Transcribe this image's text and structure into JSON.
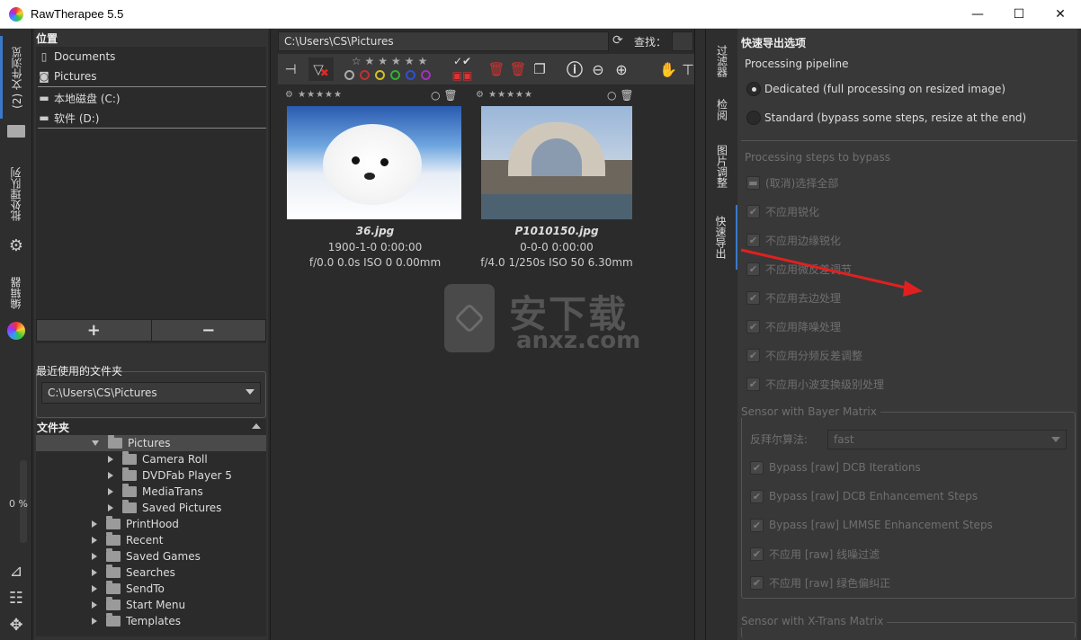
{
  "titlebar": {
    "title": "RawTherapee 5.5",
    "minimize": "—",
    "maximize": "☐",
    "close": "✕"
  },
  "left_tabs": {
    "file_browser": "(2) 文件浏览",
    "batch_queue": "批处理队列",
    "editor": "编辑器",
    "progress": "0 %"
  },
  "places": {
    "header": "位置",
    "items": [
      "Documents",
      "Pictures"
    ],
    "drives": [
      "本地磁盘 (C:)",
      "软件 (D:)"
    ],
    "add": "+",
    "remove": "−"
  },
  "recent": {
    "header": "最近使用的文件夹",
    "value": "C:\\Users\\CS\\Pictures"
  },
  "folders": {
    "header": "文件夹",
    "tree": [
      {
        "name": "Pictures",
        "expanded": true
      },
      {
        "name": "Camera Roll"
      },
      {
        "name": "DVDFab Player 5"
      },
      {
        "name": "MediaTrans"
      },
      {
        "name": "Saved Pictures"
      },
      {
        "name": "PrintHood"
      },
      {
        "name": "Recent"
      },
      {
        "name": "Saved Games"
      },
      {
        "name": "Searches"
      },
      {
        "name": "SendTo"
      },
      {
        "name": "Start Menu"
      },
      {
        "name": "Templates"
      }
    ]
  },
  "browser": {
    "path": "C:\\Users\\CS\\Pictures",
    "find_label": "查找：",
    "thumbnails": [
      {
        "filename": "36.jpg",
        "date": "1900-1-0 0:00:00",
        "exif": "f/0.0 0.0s ISO 0 0.00mm"
      },
      {
        "filename": "P1010150.jpg",
        "date": "0-0-0 0:00:00",
        "exif": "f/4.0 1/250s ISO 50 6.30mm"
      }
    ],
    "color_labels": [
      "#c03030",
      "#d0c020",
      "#30b030",
      "#3050d0",
      "#a030c0"
    ]
  },
  "watermark": {
    "zh": "安下载",
    "en": "anxz.com"
  },
  "right_tabs": [
    "过滤器",
    "检阅",
    "图片调整",
    "快速导出"
  ],
  "export": {
    "title": "快速导出选项",
    "pipeline_label": "Processing pipeline",
    "options": [
      {
        "label": "Dedicated (full processing on resized image)",
        "selected": true
      },
      {
        "label": "Standard (bypass some steps, resize at the end)",
        "selected": false
      }
    ],
    "bypass_label": "Processing steps to bypass",
    "select_all": "(取消)选择全部",
    "steps": [
      "不应用锐化",
      "不应用边缘锐化",
      "不应用微反差调节",
      "不应用去边处理",
      "不应用降噪处理",
      "不应用分频反差调整",
      "不应用小波变换级别处理"
    ],
    "bayer_title": "Sensor with Bayer Matrix",
    "demosaic_label": "反拜尔算法:",
    "demosaic_value": "fast",
    "bayer_steps": [
      "Bypass [raw] DCB Iterations",
      "Bypass [raw] DCB Enhancement Steps",
      "Bypass [raw] LMMSE Enhancement Steps",
      "不应用 [raw] 线噪过滤",
      "不应用 [raw] 绿色偏纠正"
    ],
    "xtrans_title": "Sensor with X-Trans Matrix"
  }
}
